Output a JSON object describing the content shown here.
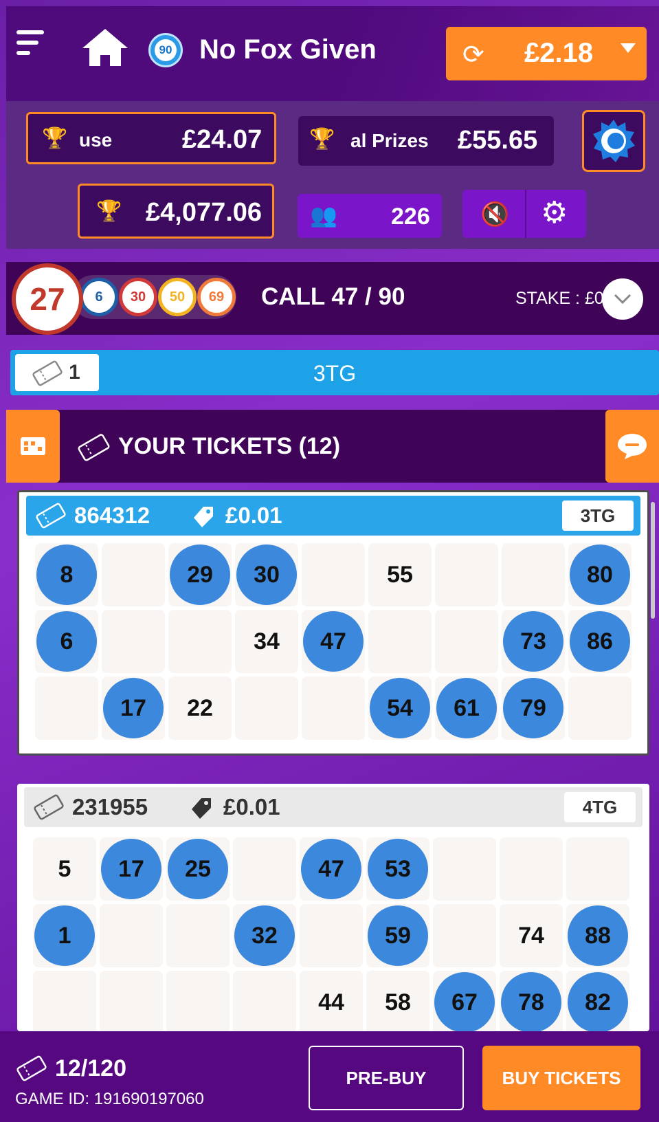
{
  "header": {
    "game_ball": "90",
    "game_name": "No Fox Given",
    "balance": "£2.18"
  },
  "prizes": {
    "house_label": "use",
    "house_value": "£24.07",
    "total_label": "al Prizes",
    "total_value": "£55.65",
    "jackpot_value": "£4,077.06",
    "players": "226"
  },
  "call": {
    "current_ball": "27",
    "history": [
      "6",
      "30",
      "50",
      "69"
    ],
    "text": "CALL 47 / 90",
    "stake": "STAKE : £0.12"
  },
  "tg_bar": {
    "count": "1",
    "label": "3TG"
  },
  "tickets_title": "YOUR TICKETS (12)",
  "tickets": [
    {
      "id": "864312",
      "price": "£0.01",
      "tg": "3TG",
      "rows": [
        [
          "8",
          "",
          "29",
          "30",
          "",
          "55",
          "",
          "",
          "80"
        ],
        [
          "6",
          "",
          "",
          "34",
          "47",
          "",
          "",
          "73",
          "86"
        ],
        [
          "",
          "17",
          "22",
          "",
          "",
          "54",
          "61",
          "79",
          ""
        ]
      ],
      "marked": [
        [
          true,
          false,
          true,
          true,
          false,
          false,
          false,
          false,
          true
        ],
        [
          true,
          false,
          false,
          false,
          true,
          false,
          false,
          true,
          true
        ],
        [
          false,
          true,
          false,
          false,
          false,
          true,
          true,
          true,
          false
        ]
      ]
    },
    {
      "id": "231955",
      "price": "£0.01",
      "tg": "4TG",
      "rows": [
        [
          "5",
          "17",
          "25",
          "",
          "47",
          "53",
          "",
          "",
          ""
        ],
        [
          "1",
          "",
          "",
          "32",
          "",
          "59",
          "",
          "74",
          "88"
        ],
        [
          "",
          "",
          "",
          "",
          "44",
          "58",
          "67",
          "78",
          "82"
        ]
      ],
      "marked": [
        [
          false,
          true,
          true,
          false,
          true,
          true,
          false,
          false,
          false
        ],
        [
          true,
          false,
          false,
          true,
          false,
          true,
          false,
          false,
          true
        ],
        [
          false,
          false,
          false,
          false,
          false,
          false,
          true,
          true,
          true
        ]
      ]
    }
  ],
  "footer": {
    "count": "12/120",
    "game_id": "GAME ID: 191690197060",
    "prebuy": "PRE-BUY",
    "buy": "BUY TICKETS"
  },
  "colors": {
    "accent_orange": "#ff8a26",
    "ticket_blue": "#2aa5e9",
    "marked_ball": "#3b88dc",
    "current_ball_red": "#c0392b",
    "ball_colors": [
      "#1f5fa8",
      "#d23a3a",
      "#f4b321",
      "#f07a3a"
    ]
  }
}
